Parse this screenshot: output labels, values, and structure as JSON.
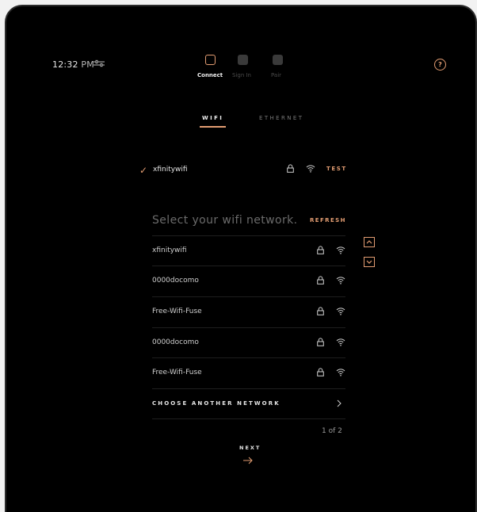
{
  "status_bar": {
    "time": "12:32",
    "meridiem": "PM"
  },
  "steps": [
    {
      "label": "Connect",
      "active": true
    },
    {
      "label": "Sign In",
      "active": false
    },
    {
      "label": "Pair",
      "active": false
    }
  ],
  "help": {
    "label": "?"
  },
  "tabs": [
    {
      "label": "WIFI",
      "active": true
    },
    {
      "label": "ETHERNET",
      "active": false
    }
  ],
  "connected": {
    "ssid": "xfinitywifi",
    "test_label": "TEST"
  },
  "network_list": {
    "heading": "Select your wifi network.",
    "refresh_label": "REFRESH",
    "networks": [
      {
        "ssid": "xfinitywifi",
        "icons": [
          "lock-icon",
          "wifi-icon"
        ]
      },
      {
        "ssid": "0000docomo",
        "icons": [
          "lock-icon",
          "wifi-icon"
        ]
      },
      {
        "ssid": "Free-Wifi-Fuse",
        "icons": [
          "lock-icon",
          "wifi-icon"
        ]
      },
      {
        "ssid": "0000docomo",
        "icons": [
          "lock-icon",
          "wifi-icon"
        ]
      },
      {
        "ssid": "Free-Wifi-Fuse",
        "icons": [
          "lock-icon",
          "wifi-icon"
        ]
      }
    ],
    "choose_another": "CHOOSE ANOTHER NETWORK",
    "pager": "1 of 2"
  },
  "footer": {
    "next_label": "NEXT"
  },
  "colors": {
    "accent": "#e39d72",
    "background": "#000000",
    "text": "#e6e6e6"
  }
}
